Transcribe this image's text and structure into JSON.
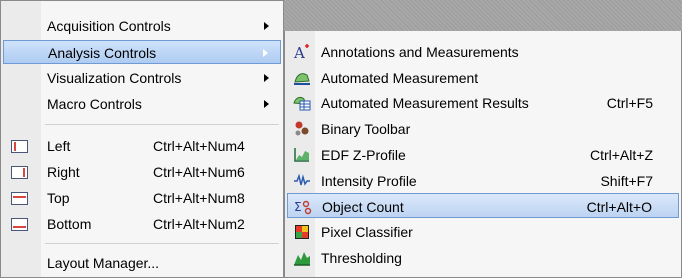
{
  "main_menu": {
    "items": [
      {
        "label": "Acquisition Controls",
        "has_submenu": true
      },
      {
        "label": "Analysis Controls",
        "has_submenu": true,
        "highlighted": true
      },
      {
        "label": "Visualization Controls",
        "has_submenu": true
      },
      {
        "label": "Macro Controls",
        "has_submenu": true
      },
      {
        "label": "Left",
        "shortcut": "Ctrl+Alt+Num4",
        "icon": "layout-left-icon"
      },
      {
        "label": "Right",
        "shortcut": "Ctrl+Alt+Num6",
        "icon": "layout-right-icon"
      },
      {
        "label": "Top",
        "shortcut": "Ctrl+Alt+Num8",
        "icon": "layout-top-icon"
      },
      {
        "label": "Bottom",
        "shortcut": "Ctrl+Alt+Num2",
        "icon": "layout-bottom-icon"
      },
      {
        "label": "Layout Manager..."
      }
    ]
  },
  "submenu": {
    "items": [
      {
        "label": "Annotations and Measurements",
        "icon": "annotations-icon"
      },
      {
        "label": "Automated Measurement",
        "icon": "automated-measurement-icon"
      },
      {
        "label": "Automated Measurement Results",
        "shortcut": "Ctrl+F5",
        "icon": "measurement-results-icon"
      },
      {
        "label": "Binary Toolbar",
        "icon": "binary-toolbar-icon"
      },
      {
        "label": "EDF Z-Profile",
        "shortcut": "Ctrl+Alt+Z",
        "icon": "edf-z-profile-icon"
      },
      {
        "label": "Intensity Profile",
        "shortcut": "Shift+F7",
        "icon": "intensity-profile-icon"
      },
      {
        "label": "Object Count",
        "shortcut": "Ctrl+Alt+O",
        "icon": "object-count-icon",
        "highlighted": true
      },
      {
        "label": "Pixel Classifier",
        "icon": "pixel-classifier-icon"
      },
      {
        "label": "Thresholding",
        "icon": "thresholding-icon"
      }
    ]
  },
  "colors": {
    "highlight_border": "#6f9ad6",
    "highlight_fill": "#bcd3f2",
    "menu_background": "#f6f6f6"
  }
}
